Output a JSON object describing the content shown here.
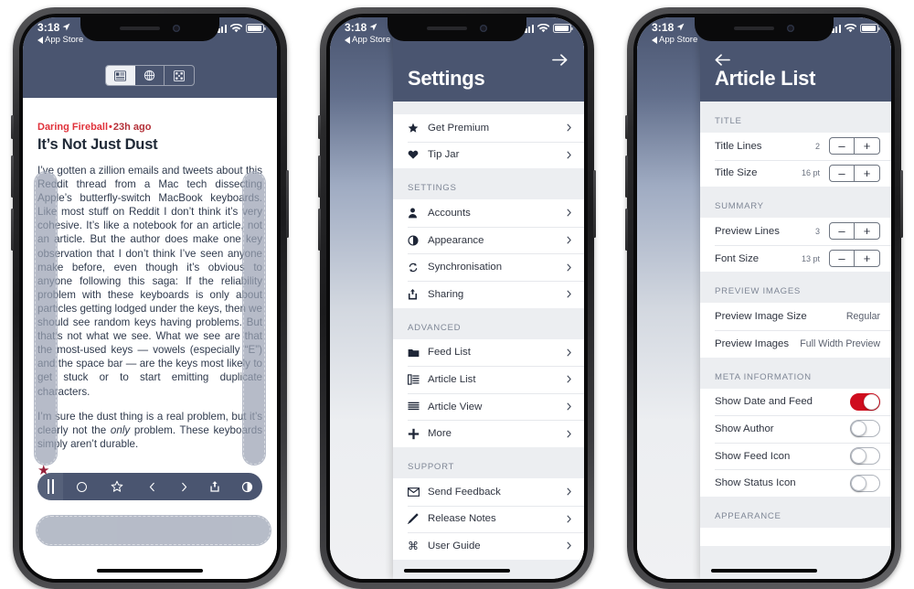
{
  "colors": {
    "navy": "#4a5570",
    "accent_red": "#e0313a",
    "toggle_on": "#cf0d1e",
    "panel_bg": "#eceef1"
  },
  "status_bar": {
    "time": "3:18",
    "back_label": "App Store",
    "location_icon": "location-arrow-icon",
    "signal_icon": "cellular-bars-icon",
    "wifi_icon": "wifi-icon",
    "battery_icon": "battery-icon"
  },
  "phone1": {
    "nav": {
      "collapse_icon": "chevron-down-icon",
      "segments": [
        {
          "name": "article-view-segment",
          "icon": "article-text-icon",
          "active": true
        },
        {
          "name": "web-view-segment",
          "icon": "globe-icon",
          "active": false
        },
        {
          "name": "reader-view-segment",
          "icon": "image-grid-icon",
          "active": false
        }
      ]
    },
    "article": {
      "source": "Daring Fireball",
      "dot": "•",
      "time_ago": "23h ago",
      "title": "It’s Not Just Dust",
      "paragraph1": "I’ve gotten a zillion emails and tweets about this Reddit thread from a Mac tech dissecting Apple’s butterfly-switch MacBook keyboards. Like most stuff on Reddit I don’t think it’s very cohesive. It’s like a notebook for an article, not an article. But the author does make one key observation that I don’t think I’ve seen anyone make before, even though it’s obvious to anyone following this saga: If the reliability problem with these keyboards is only about particles getting lodged under the keys, then we should see random keys having problems. But that’s not what we see. What we see are that the most-used keys — vowels (especially “E”) and the space bar — are the keys most likely to get stuck or to start emitting duplicate characters.",
      "paragraph2_a": "I’m sure the dust thing is a real problem, but it’s clearly not the ",
      "paragraph2_em": "only",
      "paragraph2_b": " problem. These keyboards simply aren’t durable.",
      "star_icon": "star-filled-icon"
    },
    "toolbar": {
      "handle_icon": "drag-handle-icon",
      "items": [
        {
          "name": "unread-toggle-button",
          "icon": "circle-icon"
        },
        {
          "name": "star-button",
          "icon": "star-outline-icon"
        },
        {
          "name": "previous-article-button",
          "icon": "chevron-left-icon"
        },
        {
          "name": "next-article-button",
          "icon": "chevron-right-icon"
        },
        {
          "name": "share-button",
          "icon": "share-icon"
        },
        {
          "name": "theme-button",
          "icon": "contrast-icon"
        }
      ]
    }
  },
  "phone2": {
    "header": {
      "title": "Settings",
      "forward_icon": "arrow-right-icon"
    },
    "sections": [
      {
        "heading": "",
        "rows": [
          {
            "icon": "star-filled-icon",
            "label": "Get Premium",
            "accessory": "chevron"
          },
          {
            "icon": "heart-filled-icon",
            "label": "Tip Jar",
            "accessory": "chevron"
          }
        ]
      },
      {
        "heading": "SETTINGS",
        "rows": [
          {
            "icon": "person-icon",
            "label": "Accounts",
            "accessory": "chevron"
          },
          {
            "icon": "contrast-icon",
            "label": "Appearance",
            "accessory": "chevron"
          },
          {
            "icon": "sync-icon",
            "label": "Synchronisation",
            "accessory": "chevron"
          },
          {
            "icon": "share-icon",
            "label": "Sharing",
            "accessory": "chevron"
          }
        ]
      },
      {
        "heading": "ADVANCED",
        "rows": [
          {
            "icon": "folder-icon",
            "label": "Feed List",
            "accessory": "chevron"
          },
          {
            "icon": "list-detail-icon",
            "label": "Article List",
            "accessory": "chevron"
          },
          {
            "icon": "lines-icon",
            "label": "Article View",
            "accessory": "chevron"
          },
          {
            "icon": "plus-icon",
            "label": "More",
            "accessory": "chevron"
          }
        ]
      },
      {
        "heading": "SUPPORT",
        "rows": [
          {
            "icon": "envelope-icon",
            "label": "Send Feedback",
            "accessory": "chevron"
          },
          {
            "icon": "pencil-icon",
            "label": "Release Notes",
            "accessory": "chevron"
          },
          {
            "icon": "command-icon",
            "label": "User Guide",
            "accessory": "chevron"
          }
        ]
      }
    ]
  },
  "phone3": {
    "header": {
      "title": "Article List",
      "back_icon": "arrow-left-icon"
    },
    "sections": [
      {
        "heading": "TITLE",
        "rows": [
          {
            "label": "Title Lines",
            "value": "2",
            "accessory": "stepper",
            "minus": "–",
            "plus": "+"
          },
          {
            "label": "Title Size",
            "value": "16 pt",
            "accessory": "stepper",
            "minus": "–",
            "plus": "+"
          }
        ]
      },
      {
        "heading": "SUMMARY",
        "rows": [
          {
            "label": "Preview Lines",
            "value": "3",
            "accessory": "stepper",
            "minus": "–",
            "plus": "+"
          },
          {
            "label": "Font Size",
            "value": "13 pt",
            "accessory": "stepper",
            "minus": "–",
            "plus": "+"
          }
        ]
      },
      {
        "heading": "PREVIEW IMAGES",
        "rows": [
          {
            "label": "Preview Image Size",
            "value": "Regular",
            "accessory": "value"
          },
          {
            "label": "Preview Images",
            "value": "Full Width Preview",
            "accessory": "value"
          }
        ]
      },
      {
        "heading": "META INFORMATION",
        "rows": [
          {
            "label": "Show Date and Feed",
            "accessory": "toggle",
            "on": true
          },
          {
            "label": "Show Author",
            "accessory": "toggle",
            "on": false
          },
          {
            "label": "Show Feed Icon",
            "accessory": "toggle",
            "on": false
          },
          {
            "label": "Show Status Icon",
            "accessory": "toggle",
            "on": false
          }
        ]
      },
      {
        "heading": "APPEARANCE",
        "rows": []
      }
    ]
  }
}
